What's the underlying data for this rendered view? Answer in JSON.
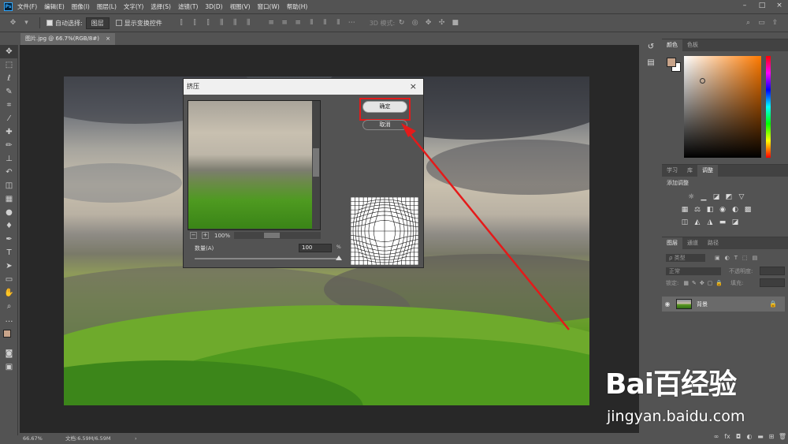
{
  "menubar": {
    "app_icon": "Ps",
    "items": [
      "文件(F)",
      "编辑(E)",
      "图像(I)",
      "图层(L)",
      "文字(Y)",
      "选择(S)",
      "滤镜(T)",
      "3D(D)",
      "视图(V)",
      "窗口(W)",
      "帮助(H)"
    ]
  },
  "options": {
    "auto_select_label": "自动选择:",
    "auto_select_value": "图层",
    "transform_label": "显示变换控件",
    "mode3d_label": "3D 模式:"
  },
  "document": {
    "tab_title": "图片.jpg @ 66.7%(RGB/8#)",
    "tab_close": "×"
  },
  "status": {
    "zoom": "66.67%",
    "doc_size": "文档:6.59M/6.59M",
    "arrow": "›"
  },
  "color_panel": {
    "tabs": [
      "颜色",
      "色板"
    ],
    "fg_color": "#c8a48a",
    "bg_color": "#ffffff"
  },
  "adjust_panel": {
    "tabs": [
      "学习",
      "库",
      "调整"
    ],
    "title": "添加调整"
  },
  "layers_panel": {
    "tabs": [
      "图层",
      "通道",
      "路径"
    ],
    "kind_label": "ρ 类型",
    "blend_mode": "正常",
    "opacity_label": "不透明度:",
    "lock_label": "锁定:",
    "fill_label": "填充:",
    "layer_name": "背景"
  },
  "dialog": {
    "title": "挤压",
    "close": "×",
    "zoom": "100%",
    "amount_label": "数量(A)",
    "amount_value": "100",
    "amount_unit": "%",
    "ok_label": "确定",
    "cancel_label": "取消"
  },
  "watermark": {
    "logo": "Bai百经验",
    "url": "jingyan.baidu.com"
  }
}
